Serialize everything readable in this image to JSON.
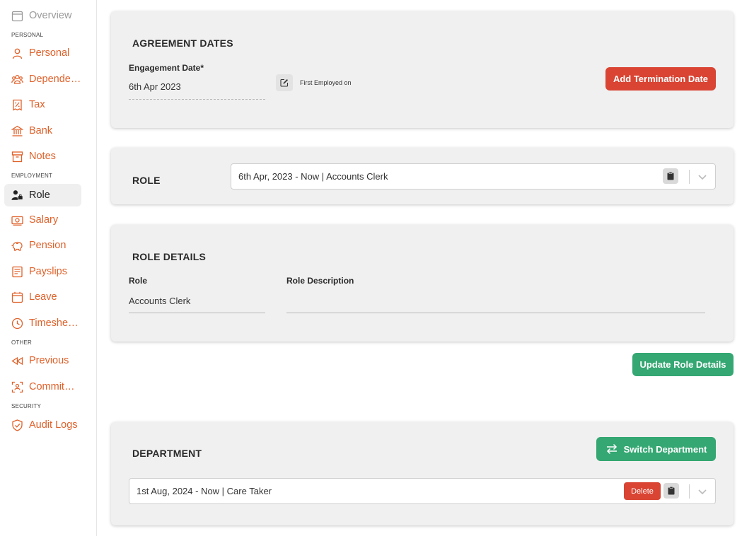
{
  "sidebar": {
    "overview": {
      "label": "Overview",
      "icon": "calendar-icon"
    },
    "sections": {
      "personal": "PERSONAL",
      "employment": "EMPLOYMENT",
      "other": "OTHER",
      "security": "SECURITY"
    },
    "personal_items": [
      {
        "label": "Personal",
        "icon": "person-icon"
      },
      {
        "label": "Dependents",
        "icon": "people-icon"
      },
      {
        "label": "Tax",
        "icon": "tax-icon"
      },
      {
        "label": "Bank",
        "icon": "bank-icon"
      },
      {
        "label": "Notes",
        "icon": "archive-icon"
      }
    ],
    "employment_items": [
      {
        "label": "Role",
        "icon": "user-role-icon",
        "active": true
      },
      {
        "label": "Salary",
        "icon": "money-icon"
      },
      {
        "label": "Pension",
        "icon": "piggy-bank-icon"
      },
      {
        "label": "Payslips",
        "icon": "payslip-icon"
      },
      {
        "label": "Leave",
        "icon": "calendar-icon"
      },
      {
        "label": "Timesheets",
        "icon": "clock-icon"
      }
    ],
    "other_items": [
      {
        "label": "Previous",
        "icon": "rewind-icon"
      },
      {
        "label": "Commitments",
        "icon": "commitments-icon"
      }
    ],
    "security_items": [
      {
        "label": "Audit Logs",
        "icon": "shield-check-icon"
      }
    ]
  },
  "agreement": {
    "title": "AGREEMENT DATES",
    "engagement_label": "Engagement Date*",
    "engagement_value": "6th Apr 2023",
    "first_employed_label": "First Employed on",
    "add_termination_label": "Add Termination Date"
  },
  "role": {
    "title": "ROLE",
    "selected": "6th Apr, 2023 - Now | Accounts Clerk"
  },
  "role_details": {
    "title": "ROLE DETAILS",
    "role_label": "Role",
    "role_value": "Accounts Clerk",
    "description_label": "Role Description",
    "description_value": ""
  },
  "update_role_label": "Update Role Details",
  "department": {
    "title": "DEPARTMENT",
    "switch_label": "Switch Department",
    "selected": "1st Aug, 2024 - Now | Care Taker",
    "delete_label": "Delete"
  },
  "colors": {
    "accent": "#e0612a",
    "danger": "#d94433",
    "success": "#34a772"
  }
}
